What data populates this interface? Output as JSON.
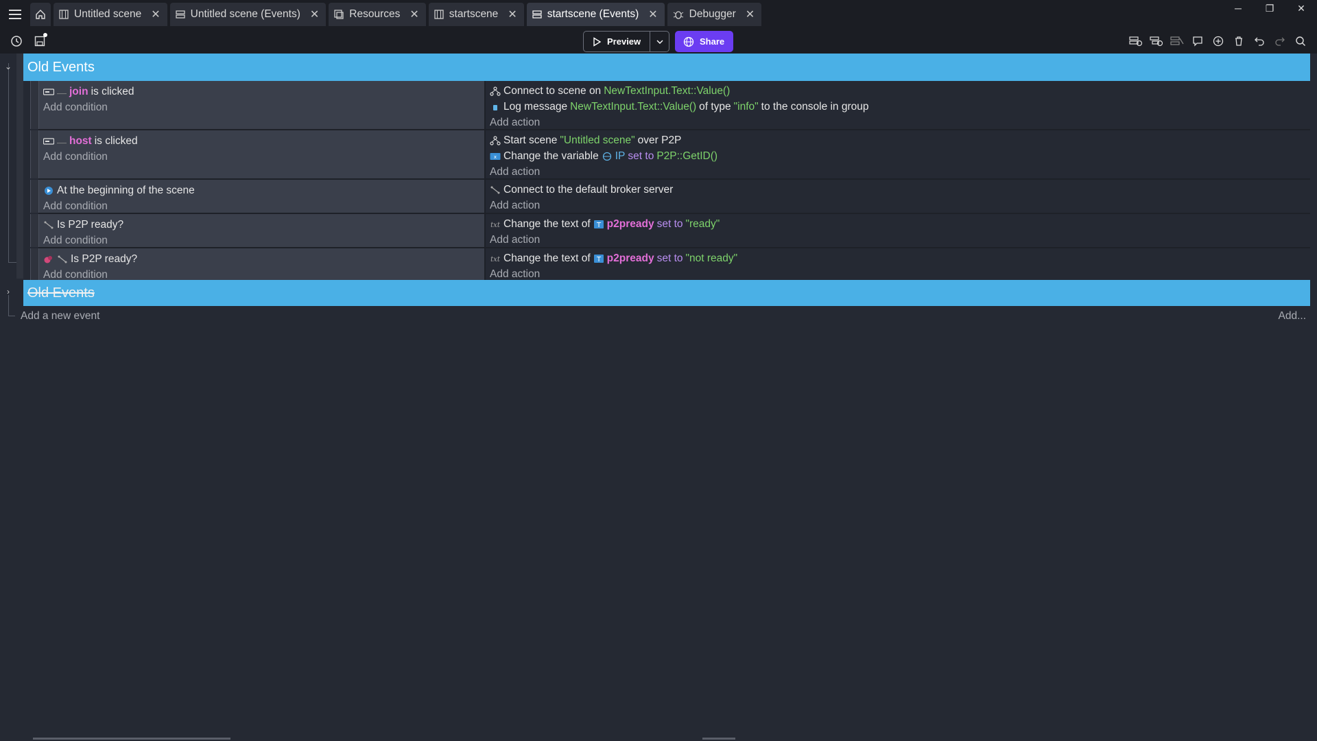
{
  "tabs": [
    {
      "label": "Untitled scene",
      "icon": "scene-icon",
      "active": false
    },
    {
      "label": "Untitled scene (Events)",
      "icon": "events-icon",
      "active": false
    },
    {
      "label": "Resources",
      "icon": "resources-icon",
      "active": false
    },
    {
      "label": "startscene",
      "icon": "scene-icon",
      "active": false
    },
    {
      "label": "startscene (Events)",
      "icon": "events-icon",
      "active": true
    },
    {
      "label": "Debugger",
      "icon": "debugger-icon",
      "active": false
    }
  ],
  "toolbar": {
    "preview_label": "Preview",
    "share_label": "Share"
  },
  "groups": {
    "first_title": "Old Events",
    "second_title": "Old Events"
  },
  "events": {
    "e1": {
      "cond_obj": "join",
      "cond_text": "is clicked",
      "add_condition": "Add condition",
      "a1_text": "Connect to scene on",
      "a1_val": "NewTextInput.Text::Value()",
      "a2_text": "Log message",
      "a2_val": "NewTextInput.Text::Value()",
      "a2_mid": "of type",
      "a2_type": "\"info\"",
      "a2_tail": "to the console in group",
      "add_action": "Add action"
    },
    "e2": {
      "cond_obj": "host",
      "cond_text": "is clicked",
      "add_condition": "Add condition",
      "a1_text": "Start scene",
      "a1_val": "\"Untitled scene\"",
      "a1_tail": "over P2P",
      "a2_text": "Change the variable",
      "a2_var": "IP",
      "a2_set": "set to",
      "a2_val": "P2P::GetID()",
      "add_action": "Add action"
    },
    "e3": {
      "cond_text": "At the beginning of the scene",
      "add_condition": "Add condition",
      "a1_text": "Connect to the default broker server",
      "add_action": "Add action"
    },
    "e4": {
      "cond_text": "Is P2P ready?",
      "add_condition": "Add condition",
      "a1_text": "Change the text of",
      "a1_obj": "p2pready",
      "a1_set": "set to",
      "a1_val": "\"ready\"",
      "add_action": "Add action"
    },
    "e5": {
      "cond_text": "Is P2P ready?",
      "add_condition": "Add condition",
      "a1_text": "Change the text of",
      "a1_obj": "p2pready",
      "a1_set": "set to",
      "a1_val": "\"not ready\"",
      "add_action": "Add action"
    }
  },
  "footer": {
    "add_event": "Add a new event",
    "add_more": "Add..."
  },
  "colors": {
    "group_header": "#4ab0e6",
    "share_button": "#6b3df2",
    "object_name": "#e36fd8",
    "string_value": "#7ed36b",
    "keyword": "#b98ef0"
  }
}
